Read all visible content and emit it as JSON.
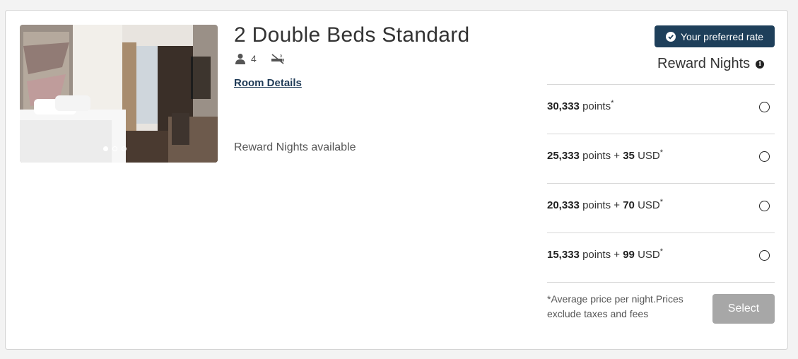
{
  "room": {
    "title": "2 Double Beds Standard",
    "occupancy": "4",
    "details_link": "Room Details",
    "availability": "Reward Nights available"
  },
  "gallery": {
    "dots": 3,
    "active_dot": 0
  },
  "badge": {
    "label": "Your preferred rate"
  },
  "rates_section": {
    "heading": "Reward Nights",
    "options": [
      {
        "points": "30,333",
        "points_unit": "points",
        "cash": "",
        "plus": "",
        "currency": "",
        "asterisk": "*"
      },
      {
        "points": "25,333",
        "points_unit": "points",
        "plus": "+",
        "cash": "35",
        "currency": "USD",
        "asterisk": "*"
      },
      {
        "points": "20,333",
        "points_unit": "points",
        "plus": "+",
        "cash": "70",
        "currency": "USD",
        "asterisk": "*"
      },
      {
        "points": "15,333",
        "points_unit": "points",
        "plus": "+",
        "cash": "99",
        "currency": "USD",
        "asterisk": "*"
      }
    ],
    "footnote": "*Average price per night.Prices exclude taxes and fees",
    "select_label": "Select"
  },
  "colors": {
    "badge_bg": "#1e3f5a",
    "link": "#1f3b57",
    "select_disabled": "#a7a7a7"
  }
}
